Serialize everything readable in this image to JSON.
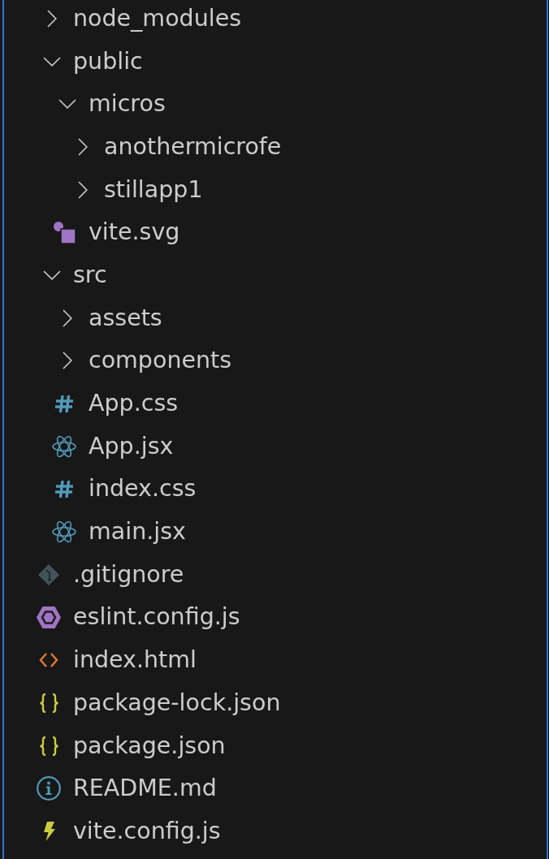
{
  "explorer": {
    "items": [
      {
        "name": "node_modules",
        "kind": "folder",
        "expanded": false
      },
      {
        "name": "public",
        "kind": "folder",
        "expanded": true,
        "children": [
          {
            "name": "micros",
            "kind": "folder",
            "expanded": true,
            "children": [
              {
                "name": "anothermicrofe",
                "kind": "folder",
                "expanded": false
              },
              {
                "name": "stillapp1",
                "kind": "folder",
                "expanded": false
              }
            ]
          },
          {
            "name": "vite.svg",
            "kind": "image"
          }
        ]
      },
      {
        "name": "src",
        "kind": "folder",
        "expanded": true,
        "children": [
          {
            "name": "assets",
            "kind": "folder",
            "expanded": false
          },
          {
            "name": "components",
            "kind": "folder",
            "expanded": false
          },
          {
            "name": "App.css",
            "kind": "stylesheet"
          },
          {
            "name": "App.jsx",
            "kind": "react"
          },
          {
            "name": "index.css",
            "kind": "stylesheet"
          },
          {
            "name": "main.jsx",
            "kind": "react"
          }
        ]
      },
      {
        "name": ".gitignore",
        "kind": "git"
      },
      {
        "name": "eslint.config.js",
        "kind": "eslint"
      },
      {
        "name": "index.html",
        "kind": "markup"
      },
      {
        "name": "package-lock.json",
        "kind": "json"
      },
      {
        "name": "package.json",
        "kind": "json"
      },
      {
        "name": "README.md",
        "kind": "readme"
      },
      {
        "name": "vite.config.js",
        "kind": "vite"
      }
    ]
  }
}
